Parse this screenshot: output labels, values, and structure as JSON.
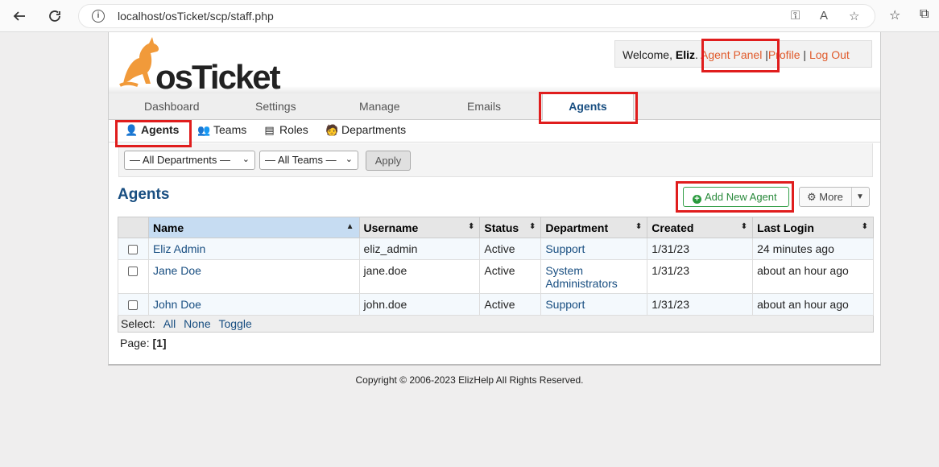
{
  "browser": {
    "url": "localhost/osTicket/scp/staff.php",
    "back_icon": "back-arrow-icon",
    "refresh_icon": "refresh-icon"
  },
  "header": {
    "logo_text": "osTicket",
    "welcome_prefix": "Welcome, ",
    "user_name": "Eliz",
    "agent_panel": "Agent Panel",
    "profile": "Profile",
    "logout": "Log Out",
    "separator": "|"
  },
  "main_nav": {
    "tabs": [
      {
        "label": "Dashboard"
      },
      {
        "label": "Settings"
      },
      {
        "label": "Manage"
      },
      {
        "label": "Emails"
      },
      {
        "label": "Agents",
        "active": true
      }
    ]
  },
  "sub_nav": {
    "items": [
      {
        "label": "Agents",
        "icon": "agent-icon",
        "active": true
      },
      {
        "label": "Teams",
        "icon": "teams-icon"
      },
      {
        "label": "Roles",
        "icon": "roles-icon"
      },
      {
        "label": "Departments",
        "icon": "departments-icon"
      }
    ]
  },
  "filters": {
    "department_selected": "— All Departments —",
    "team_selected": "— All Teams —",
    "apply_label": "Apply"
  },
  "page": {
    "title": "Agents",
    "add_button": "Add New Agent",
    "more_button": "More"
  },
  "table": {
    "columns": [
      "Name",
      "Username",
      "Status",
      "Department",
      "Created",
      "Last Login"
    ],
    "rows": [
      {
        "name": "Eliz Admin",
        "username": "eliz_admin",
        "status": "Active",
        "department": "Support",
        "created": "1/31/23",
        "last_login": "24 minutes ago"
      },
      {
        "name": "Jane Doe",
        "username": "jane.doe",
        "status": "Active",
        "department": "System Administrators",
        "created": "1/31/23",
        "last_login": "about an hour ago"
      },
      {
        "name": "John Doe",
        "username": "john.doe",
        "status": "Active",
        "department": "Support",
        "created": "1/31/23",
        "last_login": "about an hour ago"
      }
    ],
    "select_label": "Select:",
    "select_all": "All",
    "select_none": "None",
    "select_toggle": "Toggle"
  },
  "pager": {
    "label": "Page:",
    "current": "[1]"
  },
  "footer": {
    "copyright": "Copyright © 2006-2023 ElizHelp All Rights Reserved."
  },
  "colors": {
    "accent_blue": "#184e81",
    "link_orange": "#e05a2b",
    "add_green": "#2a8a3c",
    "highlight_red": "#e01d1d"
  }
}
